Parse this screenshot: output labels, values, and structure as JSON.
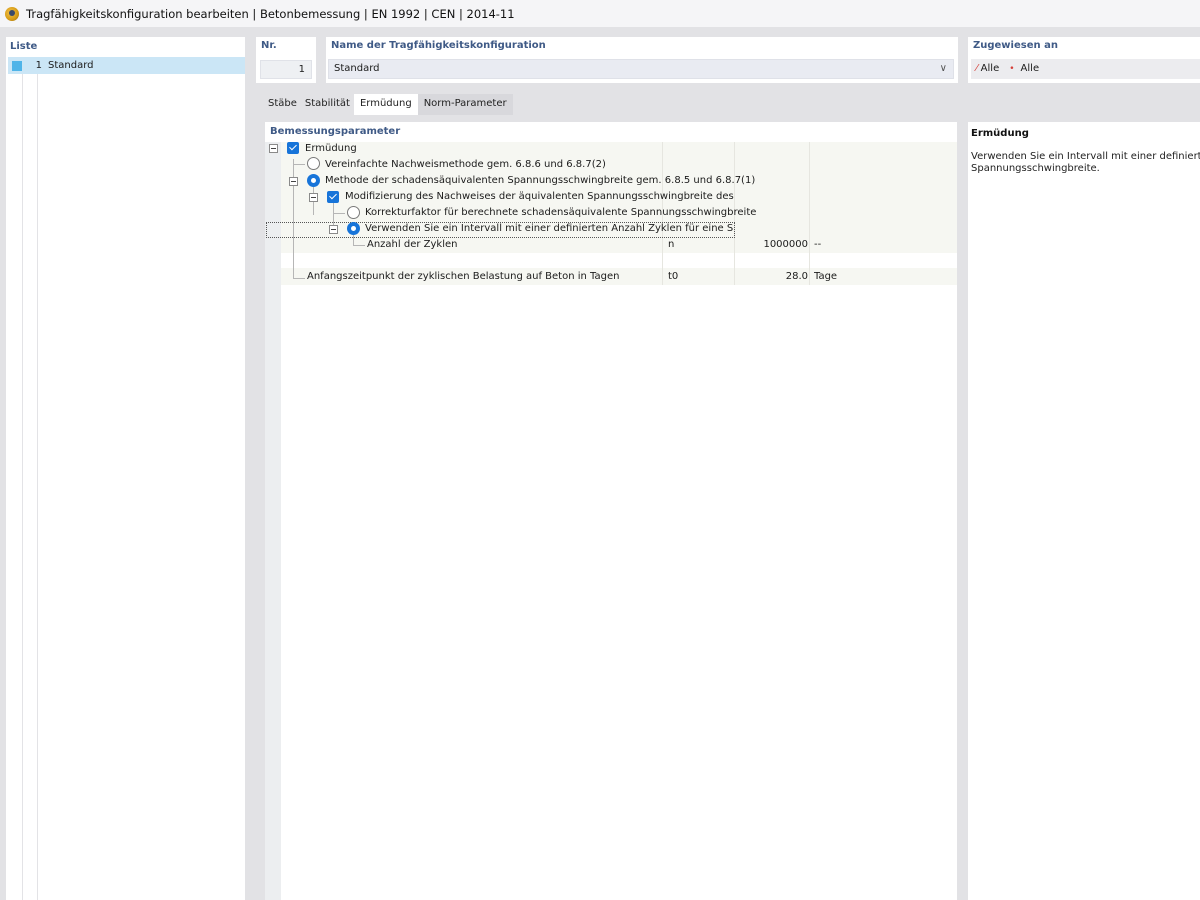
{
  "window": {
    "title": "Tragfähigkeitskonfiguration bearbeiten | Betonbemessung | EN 1992 | CEN | 2014-11"
  },
  "list": {
    "header": "Liste",
    "items": [
      {
        "number": "1",
        "name": "Standard",
        "color": "#4fb4e8"
      }
    ]
  },
  "nr": {
    "header": "Nr.",
    "value": "1"
  },
  "config_name": {
    "header": "Name der Tragfähigkeitskonfiguration",
    "value": "Standard"
  },
  "assigned": {
    "header": "Zugewiesen an",
    "value1": "Alle",
    "value2": "Alle"
  },
  "tabs": [
    "Stäbe",
    "Stabilität",
    "Ermüdung",
    "Norm-Parameter"
  ],
  "active_tab": "Ermüdung",
  "params": {
    "header": "Bemessungsparameter",
    "rows": {
      "fatigue": "Ermüdung",
      "simplified": "Vereinfachte Nachweismethode gem. 6.8.6 und 6.8.7(2)",
      "damage_equiv": "Methode der schadensäquivalenten Spannungsschwingbreite gem. 6.8.5 und 6.8.7(1)",
      "modification": "Modifizierung des Nachweises der äquivalenten Spannungsschwingbreite des Stahls",
      "correction": "Korrekturfaktor für berechnete schadensäquivalente Spannungsschwingbreite",
      "interval": "Verwenden Sie ein Intervall mit einer definierten Anzahl Zyklen für eine Spannungsschwingbreite",
      "cycles": {
        "label": "Anzahl der Zyklen",
        "symbol": "n",
        "value": "1000000",
        "unit": "--"
      },
      "start": {
        "label": "Anfangszeitpunkt der zyklischen Belastung auf Beton in Tagen",
        "symbol": "t0",
        "value": "28.0",
        "unit": "Tage"
      }
    }
  },
  "info": {
    "title": "Ermüdung",
    "description": "Verwenden Sie ein Intervall mit einer definierten Anzahl Zyklen für eine\nSpannungsschwingbreite."
  },
  "colors": {
    "accent": "#1774d9",
    "header_text": "#3f5a86",
    "selection": "#cbe6f6"
  }
}
